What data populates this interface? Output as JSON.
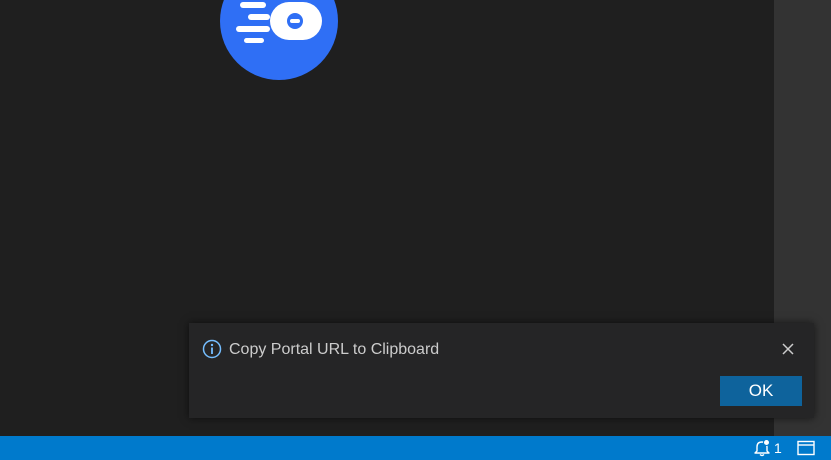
{
  "colors": {
    "editor_background": "#1f1f1f",
    "side_panel": "#333333",
    "toast_background": "#252526",
    "accent_button": "#0e639c",
    "status_bar": "#007acc",
    "logo_blue": "#2f6ff5",
    "info_icon": "#75beff"
  },
  "notification": {
    "icon": "info-icon",
    "message": "Copy Portal URL to Clipboard",
    "close_icon": "close-icon",
    "ok_label": "OK"
  },
  "status_bar": {
    "notifications_icon": "bell-icon",
    "notifications_count": "1",
    "layout_icon": "panel-layout-icon"
  }
}
